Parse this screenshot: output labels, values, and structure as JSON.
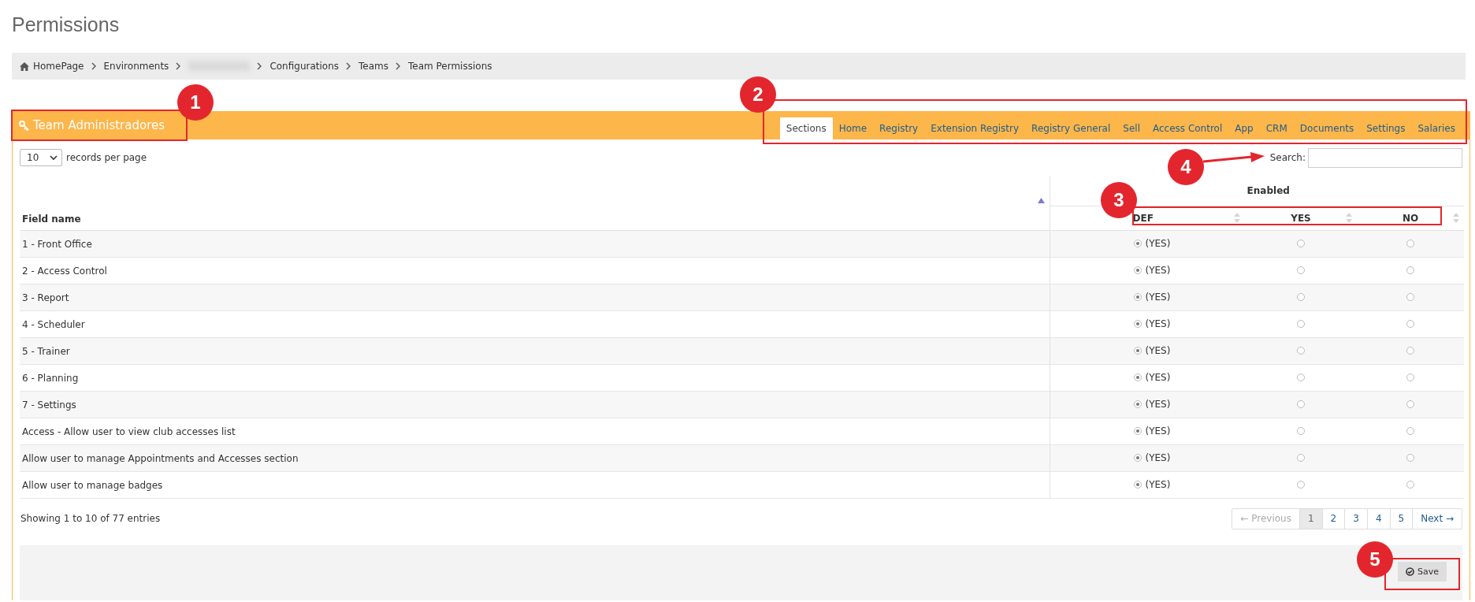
{
  "page_title": "Permissions",
  "breadcrumbs": [
    {
      "kind": "home",
      "label": "HomePage"
    },
    {
      "kind": "link",
      "label": "Environments"
    },
    {
      "kind": "blurred"
    },
    {
      "kind": "link",
      "label": "Configurations"
    },
    {
      "kind": "link",
      "label": "Teams"
    },
    {
      "kind": "link",
      "label": "Team Permissions"
    }
  ],
  "panel": {
    "title": "Team Administradores",
    "tabs": [
      {
        "label": "Sections",
        "selected": true
      },
      {
        "label": "Home",
        "selected": false
      },
      {
        "label": "Registry",
        "selected": false
      },
      {
        "label": "Extension Registry",
        "selected": false
      },
      {
        "label": "Registry General",
        "selected": false
      },
      {
        "label": "Sell",
        "selected": false
      },
      {
        "label": "Access Control",
        "selected": false
      },
      {
        "label": "App",
        "selected": false
      },
      {
        "label": "CRM",
        "selected": false
      },
      {
        "label": "Documents",
        "selected": false
      },
      {
        "label": "Settings",
        "selected": false
      },
      {
        "label": "Salaries",
        "selected": false
      }
    ]
  },
  "page_size": {
    "value": "10",
    "label": "records per page"
  },
  "search": {
    "label": "Search:"
  },
  "table": {
    "field_column": "Field name",
    "group_column": "Enabled",
    "option_columns": [
      "DEF",
      "YES",
      "NO"
    ],
    "rows": [
      {
        "name": "1 - Front Office",
        "options": [
          {
            "label": "(YES)",
            "selected": true
          },
          {
            "selected": false
          },
          {
            "selected": false
          }
        ]
      },
      {
        "name": "2 - Access Control",
        "options": [
          {
            "label": "(YES)",
            "selected": true
          },
          {
            "selected": false
          },
          {
            "selected": false
          }
        ]
      },
      {
        "name": "3 - Report",
        "options": [
          {
            "label": "(YES)",
            "selected": true
          },
          {
            "selected": false
          },
          {
            "selected": false
          }
        ]
      },
      {
        "name": "4 - Scheduler",
        "options": [
          {
            "label": "(YES)",
            "selected": true
          },
          {
            "selected": false
          },
          {
            "selected": false
          }
        ]
      },
      {
        "name": "5 - Trainer",
        "options": [
          {
            "label": "(YES)",
            "selected": true
          },
          {
            "selected": false
          },
          {
            "selected": false
          }
        ]
      },
      {
        "name": "6 - Planning",
        "options": [
          {
            "label": "(YES)",
            "selected": true
          },
          {
            "selected": false
          },
          {
            "selected": false
          }
        ]
      },
      {
        "name": "7 - Settings",
        "options": [
          {
            "label": "(YES)",
            "selected": true
          },
          {
            "selected": false
          },
          {
            "selected": false
          }
        ]
      },
      {
        "name": "Access - Allow user to view club accesses list",
        "options": [
          {
            "label": "(YES)",
            "selected": true
          },
          {
            "selected": false
          },
          {
            "selected": false
          }
        ]
      },
      {
        "name": "Allow user to manage Appointments and Accesses section",
        "options": [
          {
            "label": "(YES)",
            "selected": true
          },
          {
            "selected": false
          },
          {
            "selected": false
          }
        ]
      },
      {
        "name": "Allow user to manage badges",
        "options": [
          {
            "label": "(YES)",
            "selected": true
          },
          {
            "selected": false
          },
          {
            "selected": false
          }
        ]
      }
    ]
  },
  "info": "Showing 1 to 10 of 77 entries",
  "pagination": [
    {
      "label": "← Previous",
      "selected": false,
      "disabled": true
    },
    {
      "label": "1",
      "selected": true,
      "disabled": false
    },
    {
      "label": "2",
      "selected": false,
      "disabled": false
    },
    {
      "label": "3",
      "selected": false,
      "disabled": false
    },
    {
      "label": "4",
      "selected": false,
      "disabled": false
    },
    {
      "label": "5",
      "selected": false,
      "disabled": false
    },
    {
      "label": "Next →",
      "selected": false,
      "disabled": false
    }
  ],
  "save_button": "Save",
  "annotations": [
    {
      "number": "1"
    },
    {
      "number": "2"
    },
    {
      "number": "3"
    },
    {
      "number": "4"
    },
    {
      "number": "5"
    }
  ]
}
